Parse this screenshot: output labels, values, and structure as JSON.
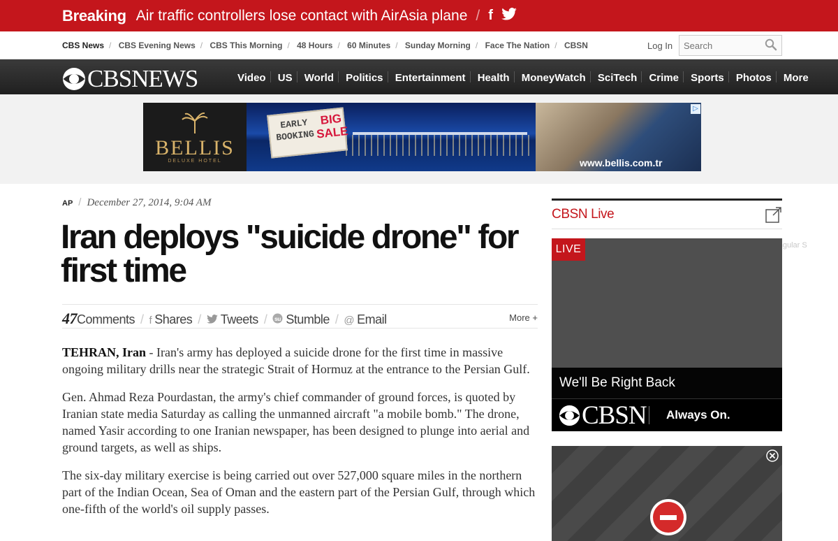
{
  "breaking": {
    "tag": "Breaking",
    "headline": "Air traffic controllers lose contact with AirAsia plane",
    "separator": "/",
    "facebook_glyph": "f",
    "twitter_icon": "twitter-icon"
  },
  "network": {
    "links": [
      "CBS News",
      "CBS Evening News",
      "CBS This Morning",
      "48 Hours",
      "60 Minutes",
      "Sunday Morning",
      "Face The Nation",
      "CBSN"
    ],
    "login": "Log In",
    "search_placeholder": "Search"
  },
  "nav": {
    "logo_text": "CBSNEWS",
    "items": [
      "Video",
      "US",
      "World",
      "Politics",
      "Entertainment",
      "Health",
      "MoneyWatch",
      "SciTech",
      "Crime",
      "Sports",
      "Photos",
      "More"
    ]
  },
  "ad_banner": {
    "brand": "BELLIS",
    "brand_sub": "DELUXE HOTEL",
    "early": "EARLY",
    "booking": "BOOKING",
    "big": "BIG",
    "sale": "SALE",
    "url": "www.bellis.com.tr",
    "adchoices": "▷"
  },
  "article": {
    "source": "AP",
    "byline_sep": "/",
    "date": "December 27, 2014, 9:04 AM",
    "title": "Iran deploys \"suicide drone\" for first time",
    "share": {
      "comments_count": "47",
      "comments_label": "Comments",
      "shares": "Shares",
      "tweets": "Tweets",
      "stumble": "Stumble",
      "email": "Email",
      "more": "More +"
    },
    "dateline": "TEHRAN, Iran",
    "para1": " - Iran's army has deployed a suicide drone for the first time in massive ongoing military drills near the strategic Strait of Hormuz at the entrance to the Persian Gulf.",
    "para2": "Gen. Ahmad Reza Pourdastan, the army's chief commander of ground forces, is quoted by Iranian state media Saturday as calling the unmanned aircraft \"a mobile bomb.\" The drone, named Yasir according to one Iranian newspaper, has been designed to plunge into aerial and ground targets, as well as ships.",
    "para3": "The six-day military exercise is being carried out over 527,000 square miles in the northern part of the Indian Ocean, Sea of Oman and the eastern part of the Persian Gulf, through which one-fifth of the world's oil supply passes."
  },
  "rail": {
    "title": "CBSN Live",
    "live_badge": "LIVE",
    "ghost_text": "Rectangular S",
    "right_back": "We'll Be Right Back",
    "cbsn_logo": "CBSN",
    "always_on": "Always On."
  },
  "colors": {
    "brand_red": "#c4161c",
    "nav_dark": "#2a2a2a"
  }
}
